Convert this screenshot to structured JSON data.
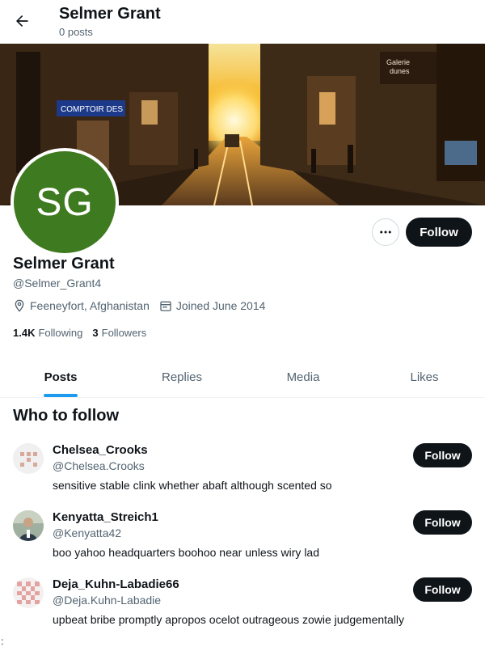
{
  "header": {
    "title": "Selmer Grant",
    "subtitle": "0 posts"
  },
  "profile": {
    "avatar_initials": "SG",
    "avatar_color": "#3e7a1f",
    "display_name": "Selmer Grant",
    "handle": "@Selmer_Grant4",
    "location": "Feeneyfort, Afghanistan",
    "joined": "Joined June 2014",
    "following_count": "1.4K",
    "following_label": "Following",
    "followers_count": "3",
    "followers_label": "Followers",
    "follow_label": "Follow"
  },
  "tabs": [
    {
      "label": "Posts",
      "active": true
    },
    {
      "label": "Replies",
      "active": false
    },
    {
      "label": "Media",
      "active": false
    },
    {
      "label": "Likes",
      "active": false
    }
  ],
  "who_to_follow": {
    "title": "Who to follow",
    "items": [
      {
        "name": "Chelsea_Crooks",
        "handle": "@Chelsea.Crooks",
        "bio": "sensitive stable clink whether abaft although scented so",
        "follow_label": "Follow"
      },
      {
        "name": "Kenyatta_Streich1",
        "handle": "@Kenyatta42",
        "bio": "boo yahoo headquarters boohoo near unless wiry lad",
        "follow_label": "Follow"
      },
      {
        "name": "Deja_Kuhn-Labadie66",
        "handle": "@Deja.Kuhn-Labadie",
        "bio": "upbeat bribe promptly apropos ocelot outrageous zowie judgementally",
        "follow_label": "Follow"
      }
    ]
  },
  "colors": {
    "accent": "#1d9bf0",
    "button_dark": "#0f1419",
    "muted_text": "#536471"
  },
  "banner": {
    "sign_text": "COMPTOIR DES",
    "shop_text_1": "Galerie",
    "shop_text_2": "dunes"
  },
  "stray_char": ":"
}
